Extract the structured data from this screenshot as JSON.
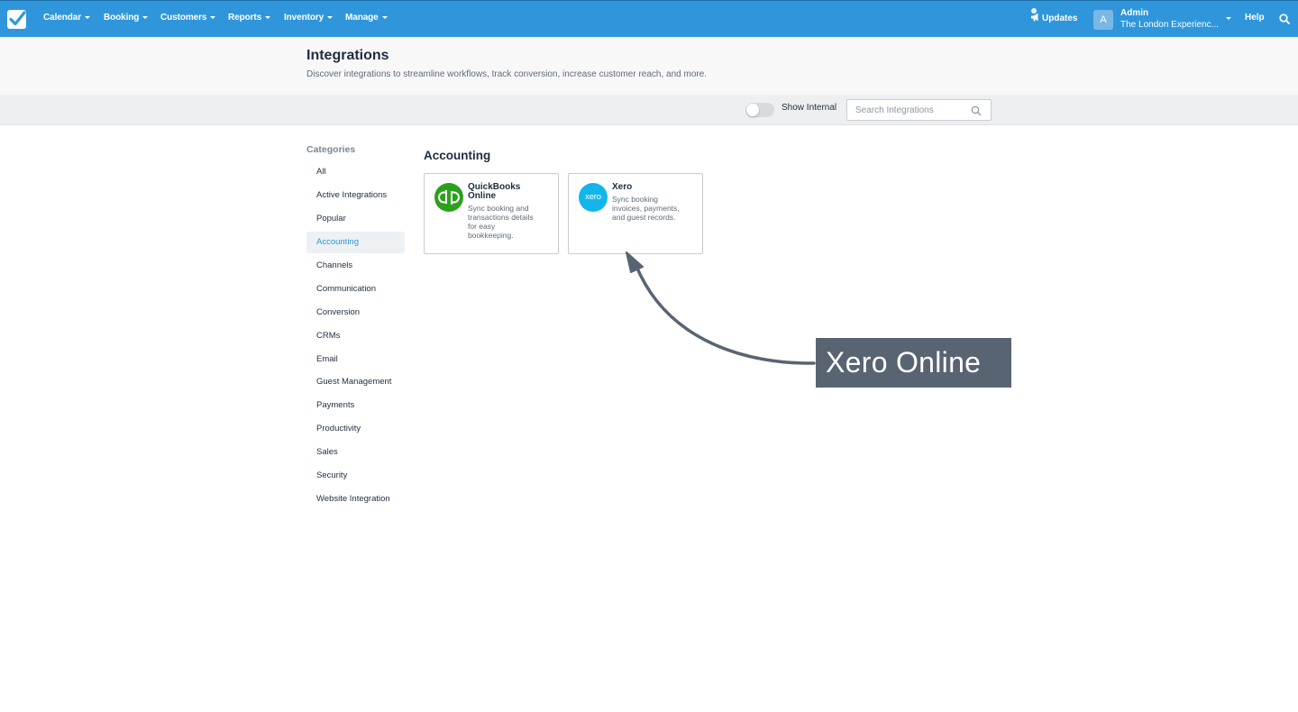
{
  "topnav": {
    "menus": [
      {
        "label": "Calendar"
      },
      {
        "label": "Booking"
      },
      {
        "label": "Customers"
      },
      {
        "label": "Reports"
      },
      {
        "label": "Inventory"
      },
      {
        "label": "Manage"
      }
    ],
    "updates_label": "Updates",
    "account": {
      "avatar_initial": "A",
      "role": "Admin",
      "company": "The London Experienc..."
    },
    "help_label": "Help",
    "icons": {
      "logo": "checkbox-logo-icon",
      "updates": "megaphone-icon",
      "search": "search-icon"
    },
    "colors": {
      "bar": "#2f96dc"
    }
  },
  "header": {
    "title": "Integrations",
    "subtitle": "Discover integrations to streamline workflows, track conversion, increase customer reach, and more."
  },
  "filters": {
    "toggle_label": "Show Internal",
    "toggle_on": false,
    "search_placeholder": "Search Integrations",
    "search_value": ""
  },
  "sidebar": {
    "heading": "Categories",
    "items": [
      {
        "label": "All"
      },
      {
        "label": "Active Integrations"
      },
      {
        "label": "Popular"
      },
      {
        "label": "Accounting",
        "active": true
      },
      {
        "label": "Channels"
      },
      {
        "label": "Communication"
      },
      {
        "label": "Conversion"
      },
      {
        "label": "CRMs"
      },
      {
        "label": "Email"
      },
      {
        "label": "Guest Management"
      },
      {
        "label": "Payments"
      },
      {
        "label": "Productivity"
      },
      {
        "label": "Sales"
      },
      {
        "label": "Security"
      },
      {
        "label": "Website Integration"
      }
    ]
  },
  "main": {
    "section_title": "Accounting",
    "cards": [
      {
        "name_line1": "QuickBooks",
        "name_line2": "Online",
        "desc_lines": [
          "Sync booking and",
          "transactions details",
          "for easy",
          "bookkeeping."
        ],
        "logo": "quickbooks-logo-icon",
        "logo_color": "#2ca01c"
      },
      {
        "name_line1": "Xero",
        "desc_lines": [
          "Sync booking",
          "invoices, payments,",
          "and guest records."
        ],
        "logo": "xero-logo-icon",
        "logo_color": "#13b5ea",
        "logo_text": "xero"
      }
    ]
  },
  "annotation": {
    "callout_text": "Xero Online",
    "callout_color": "#596472"
  }
}
